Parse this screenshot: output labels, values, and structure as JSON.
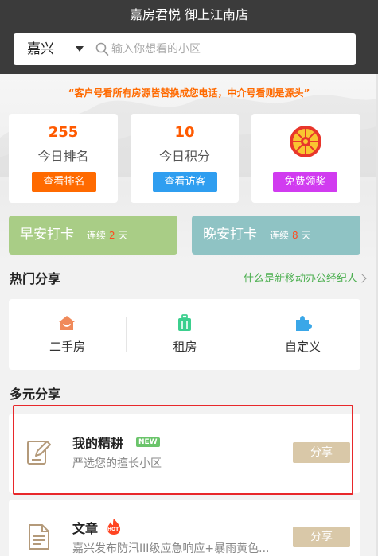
{
  "header": {
    "title": "嘉房君悦 御上江南店",
    "city": "嘉兴",
    "search_placeholder": "输入你想看的小区"
  },
  "banner": {
    "slogan": "“客户号看所有房源皆替换成您电话，中介号看则是源头”"
  },
  "stats": [
    {
      "value": "255",
      "label": "今日排名",
      "button": "查看排名",
      "button_color": "#ff6a00"
    },
    {
      "value": "10",
      "label": "今日积分",
      "button": "查看访客",
      "button_color": "#2f9ef0"
    },
    {
      "label": "",
      "button": "免费领奖",
      "button_color": "#d13bf0",
      "icon": "prize-wheel-icon"
    }
  ],
  "checkins": [
    {
      "title": "早安打卡",
      "streak_prefix": "连续",
      "days": "2",
      "streak_suffix": "天",
      "color": "#a9cd86"
    },
    {
      "title": "晚安打卡",
      "streak_prefix": "连续",
      "days": "8",
      "streak_suffix": "天",
      "color": "#8fc3c4"
    }
  ],
  "hot_share": {
    "title": "热门分享",
    "link": "什么是新移动办公经纪人",
    "items": [
      {
        "label": "二手房",
        "icon": "house-icon",
        "color": "#f08a5a"
      },
      {
        "label": "租房",
        "icon": "luggage-icon",
        "color": "#3ccf8e"
      },
      {
        "label": "自定义",
        "icon": "puzzle-icon",
        "color": "#3aa7e8"
      }
    ]
  },
  "multi_share": {
    "title": "多元分享",
    "cards": [
      {
        "title": "我的精耕",
        "tag": "NEW",
        "subtitle": "严选您的擅长小区",
        "button": "分享",
        "icon": "edit-note-icon"
      },
      {
        "title": "文章",
        "tag": "HOT",
        "subtitle": "嘉兴发布防汛III级应急响应+暴雨黄色...",
        "button": "分享",
        "icon": "document-icon"
      }
    ]
  },
  "colors": {
    "header_bg": "#3b3b3b",
    "accent_orange": "#ff5a00",
    "share_button": "#d9c8a8",
    "highlight": "#e8282b"
  }
}
